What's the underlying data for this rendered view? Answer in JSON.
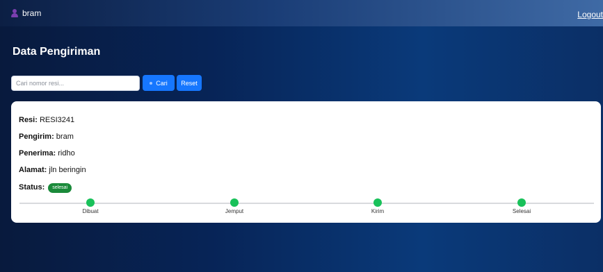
{
  "header": {
    "username": "bram",
    "logout_label": "Logout"
  },
  "page": {
    "title": "Data Pengiriman"
  },
  "search": {
    "placeholder": "Cari nomor resi...",
    "value": "",
    "search_label": "Cari",
    "reset_label": "Reset"
  },
  "shipment": {
    "resi_label": "Resi:",
    "resi": "RESI3241",
    "pengirim_label": "Pengirim:",
    "pengirim": "bram",
    "penerima_label": "Penerima:",
    "penerima": "ridho",
    "alamat_label": "Alamat:",
    "alamat": "jln beringin",
    "status_label": "Status:",
    "status": "selesai"
  },
  "timeline": {
    "steps": [
      {
        "label": "Dibuat",
        "done": true
      },
      {
        "label": "Jemput",
        "done": true
      },
      {
        "label": "Kirim",
        "done": true
      },
      {
        "label": "Selesai",
        "done": true
      }
    ]
  },
  "colors": {
    "primary_button": "#1677ff",
    "status_badge": "#1a8a3a",
    "step_done": "#19c15a"
  }
}
